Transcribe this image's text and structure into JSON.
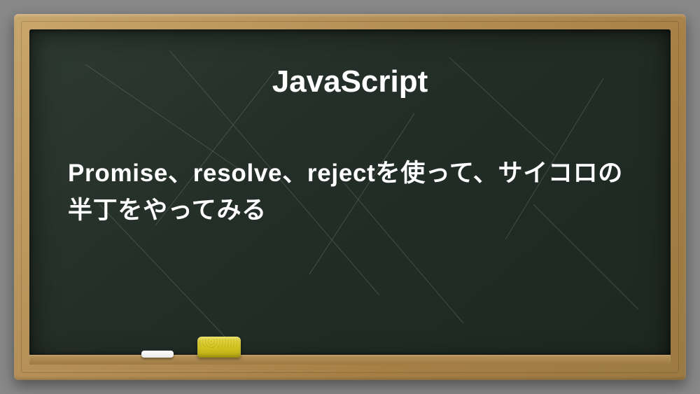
{
  "title": "JavaScript",
  "description": "Promise、resolve、rejectを使って、サイコロの半丁をやってみる"
}
